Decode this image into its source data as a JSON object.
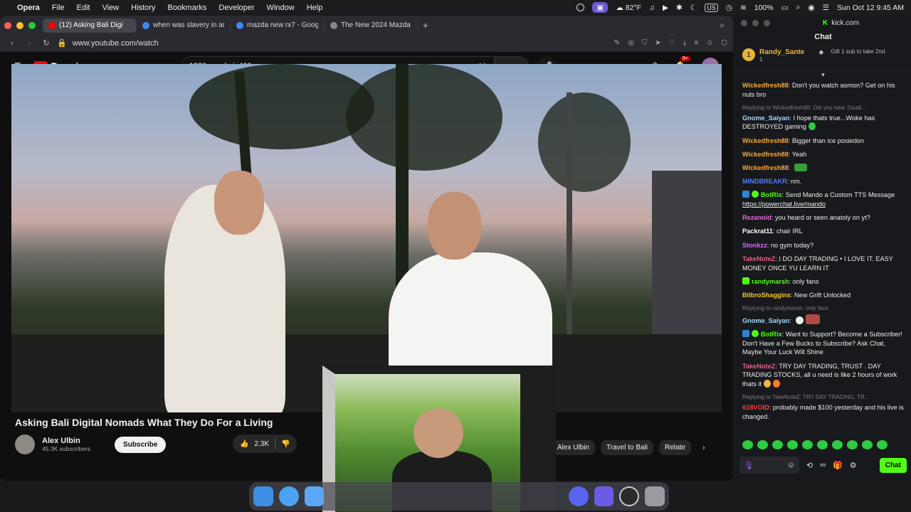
{
  "menubar": {
    "app": "Opera",
    "items": [
      "File",
      "Edit",
      "View",
      "History",
      "Bookmarks",
      "Developer",
      "Window",
      "Help"
    ],
    "temperature": "82°F",
    "keyboard": "US",
    "battery": "100%",
    "datetime": "Sun Oct 12  9:45 AM"
  },
  "browser": {
    "tabs": [
      {
        "label": "(12) Asking Bali Digi",
        "favicon_color": "#ff0000",
        "active": true
      },
      {
        "label": "when was slavery in am",
        "favicon_color": "#4285f4",
        "active": false
      },
      {
        "label": "mazda new rx7 - Google",
        "favicon_color": "#4285f4",
        "active": false
      },
      {
        "label": "The New 2024 Mazda R",
        "favicon_color": "#888888",
        "active": false
      }
    ],
    "url": "www.youtube.com/watch"
  },
  "youtube": {
    "logo_text": "Premium",
    "logo_sup": "TH",
    "search_query": "1320 murda is400",
    "notif_count": "9+",
    "video_title": "Asking Bali Digital Nomads What They Do For a Living",
    "channel_name": "Alex Ulbin",
    "channel_subs": "45.3K subscribers",
    "subscribe_label": "Subscribe",
    "like_count": "2.3K",
    "chips": [
      "Alex Ulbin",
      "Travel to Bali",
      "Relate"
    ]
  },
  "kick": {
    "site": "kick.com",
    "panel_title": "Chat",
    "gifter": {
      "rank": "1",
      "name": "Randy_Sante",
      "count": "1",
      "gift_text": "Gift 1 sub to take 2nd"
    },
    "messages": [
      {
        "user": "Wickedfresh88",
        "color": "#f3a93c",
        "text": "Don't you watch asmon? Get on his nuts bro"
      },
      {
        "reply": "Replying to Wickedfresh88: Did you hear Saudi...",
        "user": "Gnome_Saiyan",
        "color": "#a7d8ff",
        "text": "I hope thats true...Woke has DESTROYED gaming"
      },
      {
        "user": "Wickedfresh88",
        "color": "#f3a93c",
        "text": "Bigger than ice posiedon"
      },
      {
        "user": "Wickedfresh88",
        "color": "#f3a93c",
        "text": "Yeah"
      },
      {
        "user": "Wickedfresh88",
        "color": "#f3a93c",
        "text": ""
      },
      {
        "user": "MINDBREAKR",
        "color": "#4f7cff",
        "text": "nm."
      },
      {
        "user": "BotRix",
        "color": "#53fc18",
        "badge": true,
        "text": "Send Mando a Custom TTS Message ",
        "link": "https://powerchat.live/mando"
      },
      {
        "user": "Rezanoid",
        "color": "#e06bd6",
        "text": "you heard or seen anatoly on yt?"
      },
      {
        "user": "Packrat11",
        "color": "#ffffff",
        "text": "chair IRL"
      },
      {
        "user": "Stonkzz",
        "color": "#d66bff",
        "text": "no gym today?"
      },
      {
        "user": "TakeNoteZ",
        "color": "#e85d8d",
        "text": "I DO DAY TRADING • I LOVE IT. EASY MONEY ONCE YU LEARN IT"
      },
      {
        "user": "randymarsh",
        "color": "#53fc18",
        "badge": true,
        "text": "only fans"
      },
      {
        "user": "BilbroShaggins",
        "color": "#f3c63c",
        "text": "New Grift Unlocked"
      },
      {
        "reply": "Replying to randymarsh: only fans",
        "user": "Gnome_Saiyan",
        "color": "#a7d8ff",
        "text": ""
      },
      {
        "user": "BotRix",
        "color": "#53fc18",
        "badge": true,
        "text": "Want to Support? Become a Subscriber! Don't Have a Few Bucks to Subscribe? Ask Chat, Maybe Your Luck Will Shine"
      },
      {
        "user": "TakeNoteZ",
        "color": "#e85d8d",
        "text": "TRY DAY TRADING, TRUST . DAY TRADING STOCKS, all u need is like 2 hours of work thats it"
      },
      {
        "reply": "Replying to TakeNoteZ: TRY DAY TRADING, TR...",
        "user": "618VOID",
        "color": "#ff3b3b",
        "text": "probably made $100 yesterday and his live is changed."
      }
    ],
    "chat_button": "Chat"
  },
  "colors": {
    "kick_green": "#53fc18",
    "yt_red": "#ff0000"
  }
}
